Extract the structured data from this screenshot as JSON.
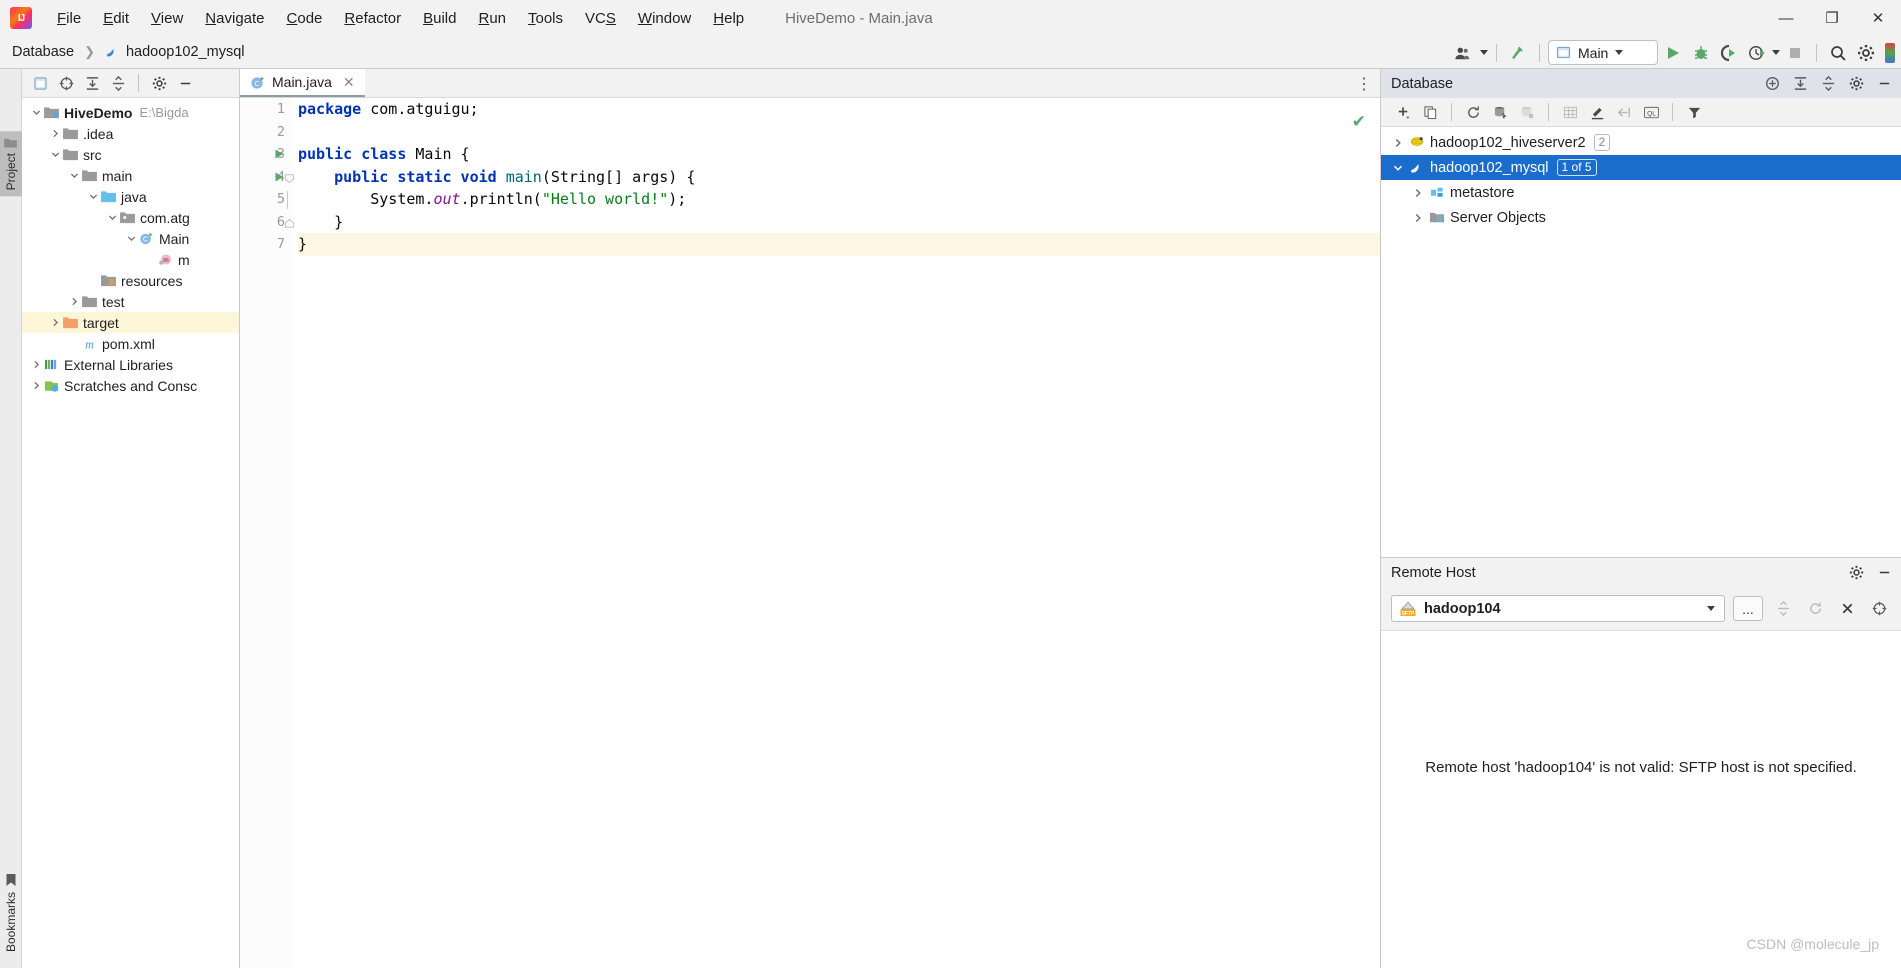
{
  "window": {
    "title": "HiveDemo - Main.java",
    "controls": {
      "minimize": "—",
      "maximize": "❐",
      "close": "✕"
    }
  },
  "menubar": {
    "items": [
      {
        "label": "File",
        "mnemonic": "F"
      },
      {
        "label": "Edit",
        "mnemonic": "E"
      },
      {
        "label": "View",
        "mnemonic": "V"
      },
      {
        "label": "Navigate",
        "mnemonic": "N"
      },
      {
        "label": "Code",
        "mnemonic": "C"
      },
      {
        "label": "Refactor",
        "mnemonic": "R"
      },
      {
        "label": "Build",
        "mnemonic": "B"
      },
      {
        "label": "Run",
        "mnemonic": "R"
      },
      {
        "label": "Tools",
        "mnemonic": "T"
      },
      {
        "label": "VCS",
        "mnemonic": "S"
      },
      {
        "label": "Window",
        "mnemonic": "W"
      },
      {
        "label": "Help",
        "mnemonic": "H"
      }
    ]
  },
  "navbar": {
    "breadcrumb": [
      {
        "label": "Database",
        "icon": "none"
      },
      {
        "label": "hadoop102_mysql",
        "icon": "mysql-dolphin-icon"
      }
    ],
    "separator": "❯",
    "run_config": {
      "label": "Main",
      "icon": "run-config-icon"
    },
    "buttons": [
      {
        "name": "user-account-icon",
        "glyph": "👤"
      },
      {
        "name": "update-project-icon",
        "glyph": "↖"
      },
      {
        "name": "run-button",
        "glyph": "▶"
      },
      {
        "name": "debug-button",
        "glyph": "🐞"
      },
      {
        "name": "run-with-coverage-button",
        "glyph": "▶"
      },
      {
        "name": "profiler-button",
        "glyph": "◴"
      },
      {
        "name": "stop-button",
        "glyph": "■"
      },
      {
        "name": "search-everywhere-icon",
        "glyph": "🔍"
      },
      {
        "name": "settings-gear-icon",
        "glyph": "⚙"
      }
    ]
  },
  "left_stripe": {
    "tabs": [
      {
        "label": "Project",
        "icon": "project-folder-icon",
        "active": true
      },
      {
        "label": "Bookmarks",
        "icon": "bookmark-icon",
        "active": false
      }
    ]
  },
  "project_panel": {
    "toolbar": [
      {
        "name": "select-opened-file-icon",
        "glyph": "▣"
      },
      {
        "name": "scroll-from-source-icon",
        "glyph": "⊕"
      },
      {
        "name": "expand-all-icon",
        "glyph": "⤓"
      },
      {
        "name": "collapse-all-icon",
        "glyph": "⤒"
      },
      {
        "name": "project-settings-gear-icon",
        "glyph": "⚙"
      },
      {
        "name": "hide-panel-icon",
        "glyph": "—"
      }
    ],
    "tree": [
      {
        "label": "HiveDemo",
        "suffix": "E:\\Bigda",
        "depth": 0,
        "arrow": "down",
        "icon": "module-icon",
        "bold": true,
        "highlight": false
      },
      {
        "label": ".idea",
        "suffix": "",
        "depth": 1,
        "arrow": "right",
        "icon": "folder-icon",
        "bold": false,
        "highlight": false
      },
      {
        "label": "src",
        "suffix": "",
        "depth": 1,
        "arrow": "down",
        "icon": "folder-icon",
        "bold": false,
        "highlight": false
      },
      {
        "label": "main",
        "suffix": "",
        "depth": 2,
        "arrow": "down",
        "icon": "folder-icon",
        "bold": false,
        "highlight": false
      },
      {
        "label": "java",
        "suffix": "",
        "depth": 3,
        "arrow": "down",
        "icon": "source-folder-icon",
        "bold": false,
        "highlight": false
      },
      {
        "label": "com.atg",
        "suffix": "",
        "depth": 4,
        "arrow": "down",
        "icon": "package-icon",
        "bold": false,
        "highlight": false
      },
      {
        "label": "Main",
        "suffix": "",
        "depth": 5,
        "arrow": "down",
        "icon": "java-class-icon",
        "bold": false,
        "highlight": false
      },
      {
        "label": "m",
        "suffix": "",
        "depth": 6,
        "arrow": "none",
        "icon": "method-icon",
        "bold": false,
        "highlight": false
      },
      {
        "label": "resources",
        "suffix": "",
        "depth": 3,
        "arrow": "none",
        "icon": "resources-folder-icon",
        "bold": false,
        "highlight": false
      },
      {
        "label": "test",
        "suffix": "",
        "depth": 2,
        "arrow": "right",
        "icon": "folder-icon",
        "bold": false,
        "highlight": false
      },
      {
        "label": "target",
        "suffix": "",
        "depth": 1,
        "arrow": "right",
        "icon": "excluded-folder-icon",
        "bold": false,
        "highlight": true
      },
      {
        "label": "pom.xml",
        "suffix": "",
        "depth": 2,
        "arrow": "none",
        "icon": "maven-icon",
        "bold": false,
        "highlight": false
      },
      {
        "label": "External Libraries",
        "suffix": "",
        "depth": 0,
        "arrow": "right",
        "icon": "libraries-icon",
        "bold": false,
        "highlight": false
      },
      {
        "label": "Scratches and Consc",
        "suffix": "",
        "depth": 0,
        "arrow": "right",
        "icon": "scratches-icon",
        "bold": false,
        "highlight": false
      }
    ]
  },
  "editor": {
    "tab": {
      "label": "Main.java",
      "icon": "java-class-icon",
      "close": "✕"
    },
    "more_icon": "⋮",
    "inspection_status": "✔",
    "lines": [
      {
        "num": "1",
        "gutter_run": false,
        "tokens": [
          {
            "t": "package ",
            "c": "kw"
          },
          {
            "t": "com.atguigu;",
            "c": "plain"
          }
        ],
        "indent": 0,
        "current": false
      },
      {
        "num": "2",
        "gutter_run": false,
        "tokens": [],
        "indent": 0,
        "current": false
      },
      {
        "num": "3",
        "gutter_run": true,
        "tokens": [
          {
            "t": "public class ",
            "c": "kw"
          },
          {
            "t": "Main {",
            "c": "plain"
          }
        ],
        "indent": 0,
        "current": false
      },
      {
        "num": "4",
        "gutter_run": true,
        "tokens": [
          {
            "t": "    public static void ",
            "c": "kw"
          },
          {
            "t": "main",
            "c": "mth"
          },
          {
            "t": "(String[] args) {",
            "c": "plain"
          }
        ],
        "indent": 0,
        "current": false
      },
      {
        "num": "5",
        "gutter_run": false,
        "tokens": [
          {
            "t": "        System.",
            "c": "plain"
          },
          {
            "t": "out",
            "c": "fld"
          },
          {
            "t": ".println(",
            "c": "plain"
          },
          {
            "t": "\"Hello world!\"",
            "c": "str"
          },
          {
            "t": ");",
            "c": "plain"
          }
        ],
        "indent": 0,
        "current": false
      },
      {
        "num": "6",
        "gutter_run": false,
        "tokens": [
          {
            "t": "    }",
            "c": "plain"
          }
        ],
        "indent": 0,
        "current": false
      },
      {
        "num": "7",
        "gutter_run": false,
        "tokens": [
          {
            "t": "}",
            "c": "plain"
          }
        ],
        "indent": 0,
        "current": true
      }
    ]
  },
  "database_panel": {
    "title": "Database",
    "header_buttons": [
      {
        "name": "add-data-source-icon",
        "glyph": "⊕"
      },
      {
        "name": "expand-all-icon",
        "glyph": "⤓"
      },
      {
        "name": "collapse-all-icon",
        "glyph": "⤒"
      },
      {
        "name": "settings-gear-icon",
        "glyph": "⚙"
      },
      {
        "name": "hide-panel-icon",
        "glyph": "—"
      }
    ],
    "toolbar": [
      {
        "name": "new-icon",
        "glyph": "+"
      },
      {
        "name": "duplicate-icon",
        "glyph": "❐"
      },
      {
        "name": "refresh-icon",
        "glyph": "⟳"
      },
      {
        "name": "synchronize-icon",
        "glyph": "≣"
      },
      {
        "name": "database-diff-icon",
        "glyph": "⊟"
      },
      {
        "name": "data-editor-icon",
        "glyph": "▦"
      },
      {
        "name": "modify-icon",
        "glyph": "✎"
      },
      {
        "name": "jump-to-editor-icon",
        "glyph": "⇥"
      },
      {
        "name": "query-console-icon",
        "glyph": "QL"
      },
      {
        "name": "filter-icon",
        "glyph": "▼"
      }
    ],
    "tree": [
      {
        "label": "hadoop102_hiveserver2",
        "badge": "2",
        "depth": 0,
        "arrow": "right",
        "icon": "hive-icon",
        "selected": false
      },
      {
        "label": "hadoop102_mysql",
        "badge": "1 of 5",
        "depth": 0,
        "arrow": "down",
        "icon": "mysql-dolphin-icon",
        "selected": true
      },
      {
        "label": "metastore",
        "badge": "",
        "depth": 1,
        "arrow": "right",
        "icon": "schema-icon",
        "selected": false
      },
      {
        "label": "Server Objects",
        "badge": "",
        "depth": 1,
        "arrow": "right",
        "icon": "server-objects-icon",
        "selected": false
      }
    ]
  },
  "remote_host_panel": {
    "title": "Remote Host",
    "header_buttons": [
      {
        "name": "settings-gear-icon",
        "glyph": "⚙"
      },
      {
        "name": "hide-panel-icon",
        "glyph": "—"
      }
    ],
    "selected_host": "hadoop104",
    "host_icon_label": "SFTP",
    "browse_button": "...",
    "toolbar": [
      {
        "name": "collapse-all-icon",
        "glyph": "⤒"
      },
      {
        "name": "refresh-icon",
        "glyph": "⟳"
      },
      {
        "name": "close-connection-icon",
        "glyph": "✕"
      },
      {
        "name": "sync-target-icon",
        "glyph": "⊕"
      }
    ],
    "message": "Remote host 'hadoop104' is not valid: SFTP host is not specified."
  },
  "watermark": "CSDN @molecule_jp",
  "colors": {
    "selection_blue": "#1a6dcc",
    "keyword_blue": "#0033b3",
    "string_green": "#067d17",
    "field_purple": "#871094",
    "method_teal": "#00627a",
    "highlight_yellow": "#fdf6d8",
    "panel_header": "#dfe3e9"
  }
}
